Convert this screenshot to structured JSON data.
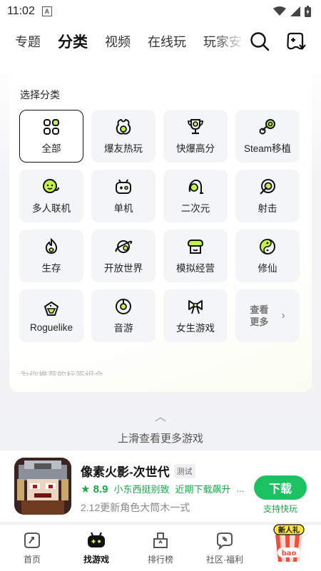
{
  "status": {
    "time": "11:02"
  },
  "nav": {
    "tabs": [
      "专题",
      "分类",
      "视频",
      "在线玩",
      "玩家安"
    ],
    "active_index": 1
  },
  "category": {
    "title": "选择分类",
    "items": [
      {
        "label": "全部",
        "icon": "grid-icon",
        "selected": true
      },
      {
        "label": "爆友热玩",
        "icon": "bag-icon"
      },
      {
        "label": "快爆高分",
        "icon": "trophy-icon"
      },
      {
        "label": "Steam移植",
        "icon": "steam-icon"
      },
      {
        "label": "多人联机",
        "icon": "multiplayer-icon"
      },
      {
        "label": "单机",
        "icon": "gamepad-icon"
      },
      {
        "label": "二次元",
        "icon": "anime-icon"
      },
      {
        "label": "射击",
        "icon": "target-icon"
      },
      {
        "label": "生存",
        "icon": "fire-icon"
      },
      {
        "label": "开放世界",
        "icon": "planet-icon"
      },
      {
        "label": "模拟经营",
        "icon": "shop-icon"
      },
      {
        "label": "修仙",
        "icon": "yinyang-icon"
      },
      {
        "label": "Roguelike",
        "icon": "dice-icon"
      },
      {
        "label": "音游",
        "icon": "disc-icon"
      },
      {
        "label": "女生游戏",
        "icon": "bow-icon"
      }
    ],
    "more_label": "查看更多",
    "recommend_label": "为你推荐的标签组合"
  },
  "swipe_hint": "上滑查看更多游戏",
  "game": {
    "title": "像素火影-次世代",
    "tag": "测试",
    "score": "8.9",
    "developer": "小东西挺别致",
    "hot": "近期下载飙升",
    "ellipsis": "...",
    "desc": "2.12更新角色大筒木一式",
    "download_label": "下载",
    "download_sub": "支持快玩"
  },
  "bottom_nav": [
    {
      "label": "首页",
      "icon": "home-icon"
    },
    {
      "label": "找游戏",
      "icon": "find-game-icon",
      "active": true
    },
    {
      "label": "排行榜",
      "icon": "rank-icon"
    },
    {
      "label": "社区·福利",
      "icon": "community-icon"
    },
    {
      "label": "",
      "icon": "new-user-gift-icon"
    }
  ],
  "promo_text": {
    "top": "新人礼",
    "bottom": "bao"
  },
  "colors": {
    "accent": "#b8f240",
    "download": "#1cc162",
    "green_text": "#19a84a"
  }
}
